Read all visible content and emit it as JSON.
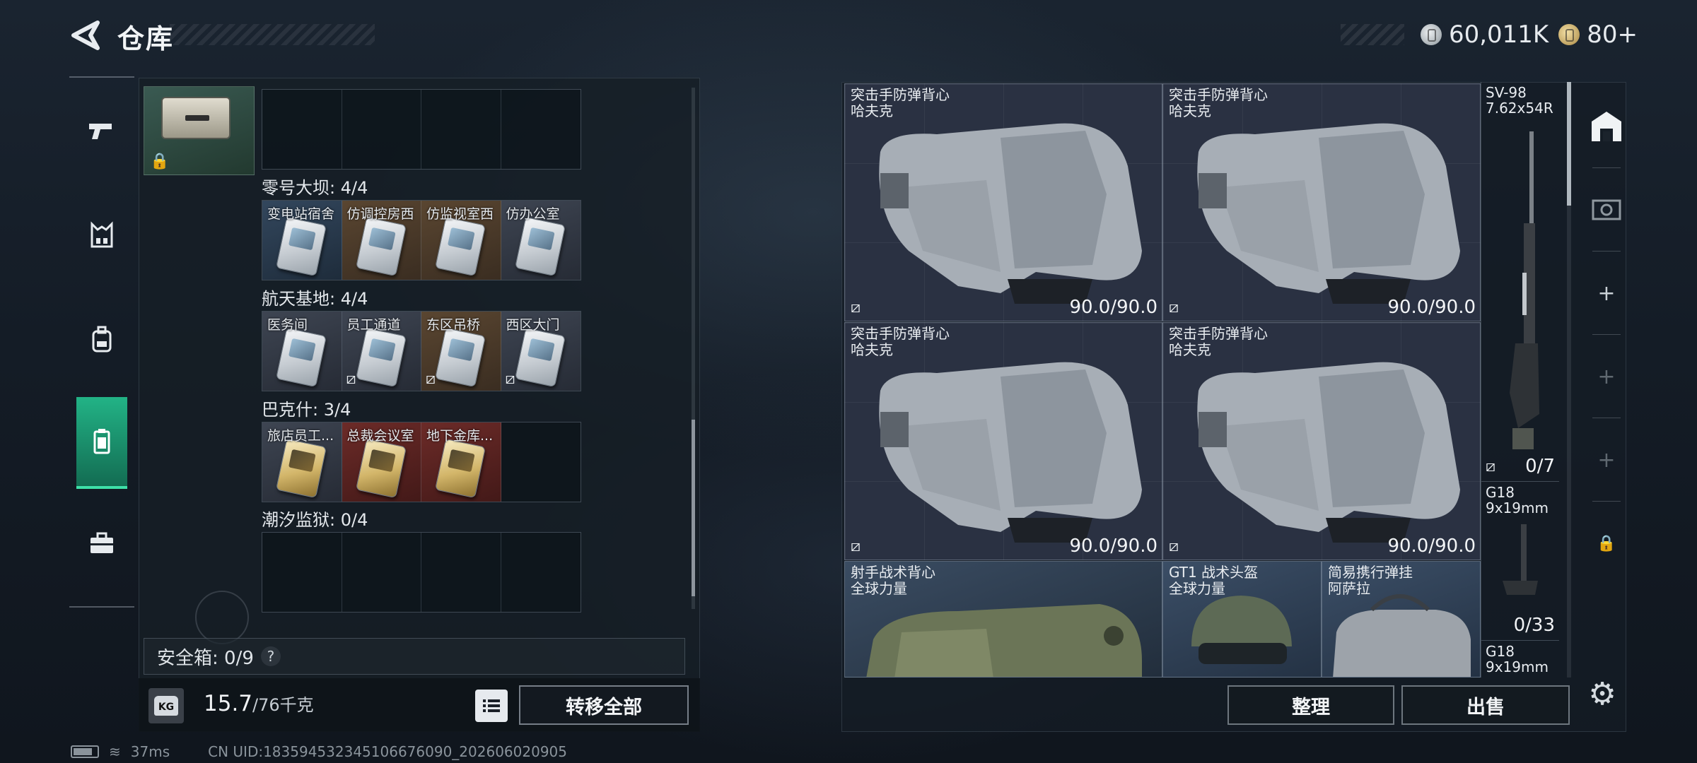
{
  "header": {
    "title": "仓库"
  },
  "currency": [
    {
      "icon": "silver-coin-icon",
      "value": "60,011K"
    },
    {
      "icon": "gold-coin-icon",
      "value": "80+"
    }
  ],
  "left_nav": [
    "weapon-tab",
    "armor-rig-tab",
    "backpack-tab",
    "keycard-tab",
    "toolbox-tab"
  ],
  "sections": [
    {
      "title": "零号大坝: 4/4",
      "cells": [
        {
          "label": "变电站宿舍",
          "tone": "blue",
          "locked": false
        },
        {
          "label": "仿调控房西",
          "tone": "brown",
          "locked": false
        },
        {
          "label": "仿监视室西",
          "tone": "brown",
          "locked": false
        },
        {
          "label": "仿办公室",
          "tone": "darkgrey",
          "locked": false
        }
      ]
    },
    {
      "title": "航天基地: 4/4",
      "cells": [
        {
          "label": "医务间",
          "tone": "darkgrey",
          "locked": false
        },
        {
          "label": "员工通道",
          "tone": "darkgrey",
          "locked": true
        },
        {
          "label": "东区吊桥",
          "tone": "brown",
          "locked": true
        },
        {
          "label": "西区大门",
          "tone": "darkgrey",
          "locked": true
        }
      ]
    },
    {
      "title": "巴克什: 3/4",
      "cells": [
        {
          "label": "旅店员工...",
          "tone": "darkgrey",
          "locked": false
        },
        {
          "label": "总裁会议室",
          "tone": "red",
          "locked": false
        },
        {
          "label": "地下金库...",
          "tone": "red",
          "locked": false
        },
        {
          "label": "",
          "tone": "empty",
          "locked": false
        }
      ]
    },
    {
      "title": "潮汐监狱: 0/4",
      "cells": []
    }
  ],
  "safebox": {
    "label": "安全箱: 0/9",
    "help": "?"
  },
  "weight": {
    "current": "15.7",
    "max": "/76千克",
    "icon_label": "KG"
  },
  "buttons": {
    "transfer_all": "转移全部",
    "tidy": "整理",
    "sell": "出售"
  },
  "vests": [
    {
      "name": "突击手防弹背心\n哈夫克",
      "durability": "90.0/90.0"
    },
    {
      "name": "突击手防弹背心\n哈夫克",
      "durability": "90.0/90.0"
    },
    {
      "name": "突击手防弹背心\n哈夫克",
      "durability": "90.0/90.0"
    },
    {
      "name": "突击手防弹背心\n哈夫克",
      "durability": "90.0/90.0"
    }
  ],
  "bottom_items": [
    {
      "name": "射手战术背心\n全球力量"
    },
    {
      "name": "GT1 战术头盔\n全球力量"
    },
    {
      "name": "简易携行弹挂\n阿萨拉"
    }
  ],
  "weapons": [
    {
      "name": "SV-98\n7.62x54R",
      "count": "0/7"
    },
    {
      "name": "G18\n9x19mm",
      "count": "0/33"
    },
    {
      "name": "G18\n9x19mm",
      "count": ""
    }
  ],
  "status": {
    "ping": "37ms",
    "uid": "CN UID:18359453234510667609​0_202606020905"
  },
  "colors": {
    "accent": "#22b386",
    "panel": "#161e26"
  }
}
